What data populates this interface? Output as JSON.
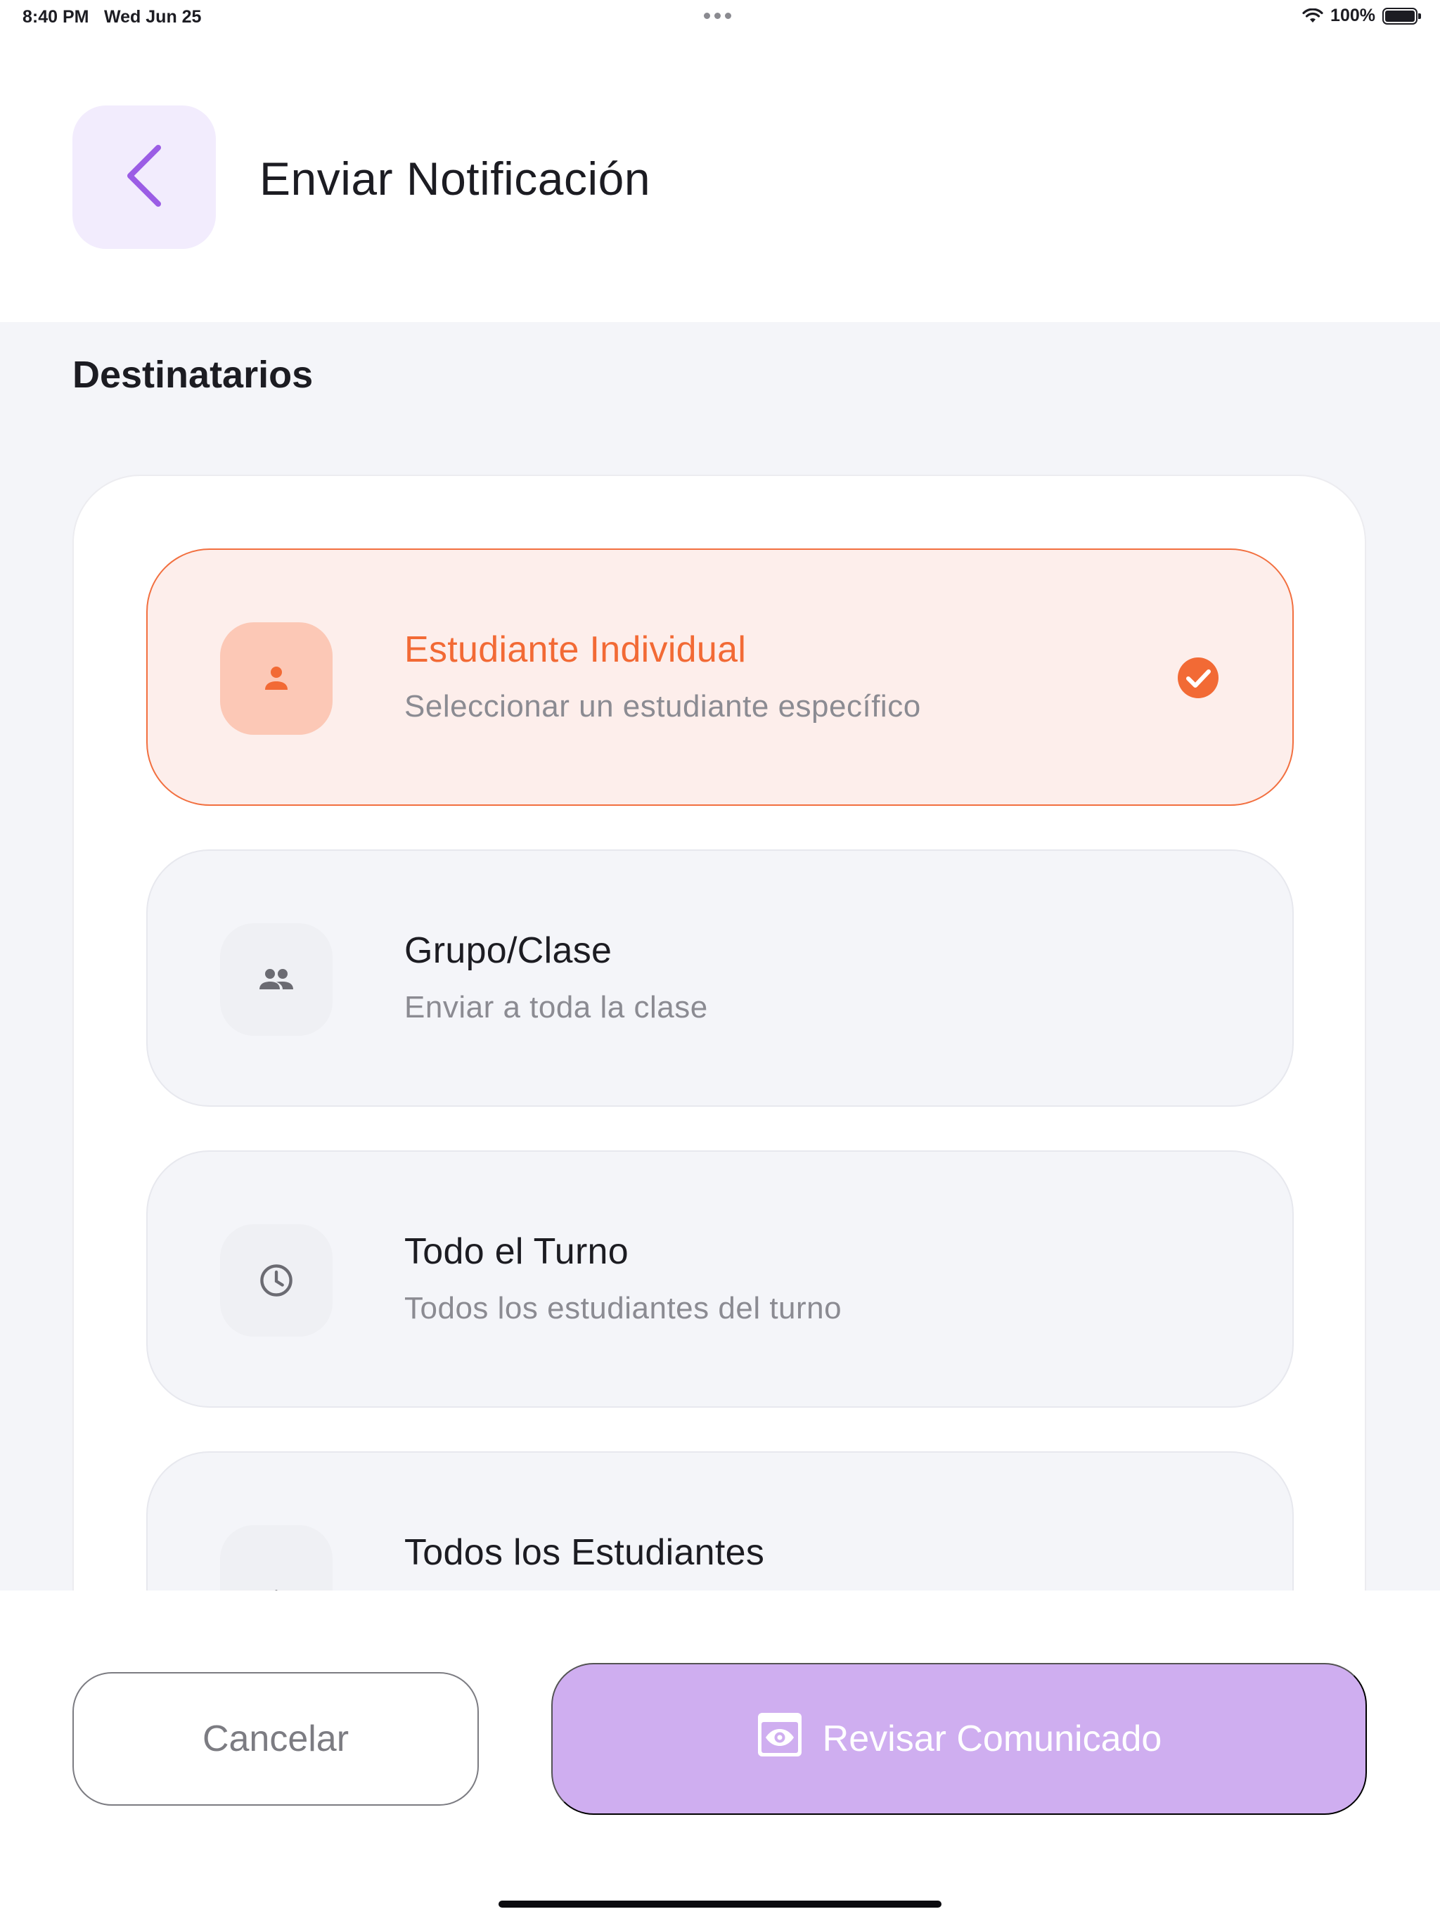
{
  "status_bar": {
    "time": "8:40 PM",
    "date": "Wed Jun 25",
    "battery": "100%"
  },
  "header": {
    "title": "Enviar Notificación",
    "back_icon": "chevron-left-icon"
  },
  "recipients": {
    "section_title": "Destinatarios",
    "options": [
      {
        "title": "Estudiante Individual",
        "subtitle": "Seleccionar un estudiante específico",
        "icon": "person-icon",
        "selected": true
      },
      {
        "title": "Grupo/Clase",
        "subtitle": "Enviar a toda la clase",
        "icon": "group-icon",
        "selected": false
      },
      {
        "title": "Todo el Turno",
        "subtitle": "Todos los estudiantes del turno",
        "icon": "clock-icon",
        "selected": false
      },
      {
        "title": "Todos los Estudiantes",
        "subtitle": "",
        "icon": "graduation-cap-icon",
        "selected": false
      }
    ]
  },
  "footer": {
    "cancel_label": "Cancelar",
    "review_label": "Revisar Comunicado",
    "review_icon": "preview-eye-icon"
  },
  "colors": {
    "accent_orange": "#f26a35",
    "selected_bg": "#fdeeeb",
    "purple": "#9b5de5",
    "purple_button": "#cfaef0",
    "content_bg": "#f4f5f9"
  }
}
